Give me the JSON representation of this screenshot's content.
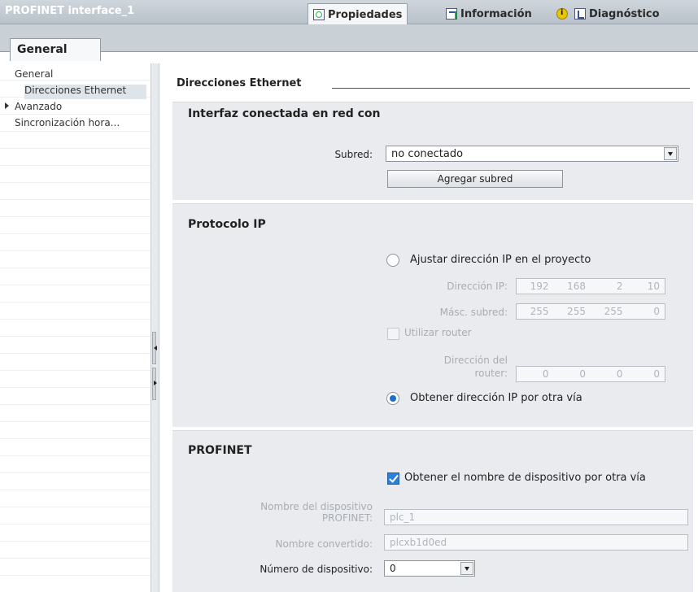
{
  "title_bar": {
    "title": "PROFINET interface_1",
    "tabs": [
      {
        "label": "Propiedades",
        "icon": "properties-icon"
      },
      {
        "label": "Información",
        "icon": "info-icon"
      },
      {
        "label": "Diagnóstico",
        "icon": "diagnostics-icon"
      }
    ]
  },
  "tabs": {
    "general": "General"
  },
  "sidebar": {
    "items": [
      {
        "label": "General"
      },
      {
        "label": "Direcciones Ethernet"
      },
      {
        "label": "Avanzado"
      },
      {
        "label": "Sincronización hora..."
      }
    ]
  },
  "section": {
    "title": "Direcciones Ethernet"
  },
  "network": {
    "title": "Interfaz conectada en red con",
    "subnet_label": "Subred:",
    "subnet_value": "no conectado",
    "add_subnet_button": "Agregar subred"
  },
  "ip_protocol": {
    "title": "Protocolo IP",
    "set_ip_option": "Ajustar dirección IP en el proyecto",
    "ip_label": "Dirección IP:",
    "ip_octets": [
      "192",
      "168",
      "2",
      "10"
    ],
    "mask_label": "Másc. subred:",
    "mask_octets": [
      "255",
      "255",
      "255",
      "0"
    ],
    "router_checkbox": "Utilizar router",
    "router_label_line1": "Dirección del",
    "router_label_line2": "router:",
    "router_octets": [
      "0",
      "0",
      "0",
      "0"
    ],
    "other_way_option": "Obtener dirección IP por otra vía"
  },
  "profinet": {
    "title": "PROFINET",
    "name_other_way": "Obtener el nombre de dispositivo por otra vía",
    "device_name_label_line1": "Nombre del dispositivo",
    "device_name_label_line2": "PROFINET:",
    "device_name_value": "plc_1",
    "converted_name_label": "Nombre convertido:",
    "converted_name_value": "plcxb1d0ed",
    "device_number_label": "Número de dispositivo:",
    "device_number_value": "0"
  }
}
